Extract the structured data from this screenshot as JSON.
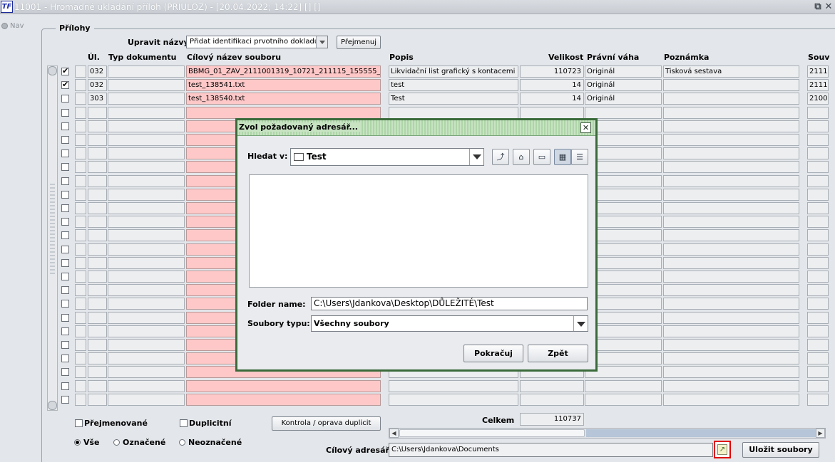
{
  "window": {
    "title": "11001 - Hromadné ukládání příloh (PRIULOZ) - [20.04.2022; 14:22] [] []",
    "logo": "TF"
  },
  "nav": {
    "label": "Nav"
  },
  "group": {
    "title": "Přílohy"
  },
  "controls": {
    "rename_label": "Upravit názvy",
    "rename_value": "Přidat identifikaci prvotního dokladu",
    "rename_button": "Přejmenuj"
  },
  "table": {
    "headers": {
      "ul": "Úl.",
      "typ": "Typ dokumentu",
      "nazev": "Cílový název souboru",
      "popis": "Popis",
      "velikost": "Velikost",
      "vaha": "Právní váha",
      "poznamka": "Poznámka",
      "souv": "Souv"
    },
    "rows": [
      {
        "checked": true,
        "ul": "032",
        "typ": "",
        "nazev": "BBMG_01_ZAV_2111001319_10721_211115_155555_",
        "popis": "Likvidační list grafický s kontacemi",
        "velikost": "110723",
        "vaha": "Originál",
        "poznamka": "Tisková sestava",
        "souv": "2111"
      },
      {
        "checked": true,
        "ul": "032",
        "typ": "",
        "nazev": "test_138541.txt",
        "popis": "test",
        "velikost": "14",
        "vaha": "Originál",
        "poznamka": "",
        "souv": "2111"
      },
      {
        "checked": false,
        "ul": "303",
        "typ": "",
        "nazev": "test_138540.txt",
        "popis": "Test",
        "velikost": "14",
        "vaha": "Originál",
        "poznamka": "",
        "souv": "2100"
      }
    ],
    "empty_rows": 22
  },
  "bottom": {
    "prejmenovane": "Přejmenované",
    "duplicitni": "Duplicitní",
    "kontrola_button": "Kontrola / oprava duplicit",
    "celkem_label": "Celkem",
    "celkem_value": "110737",
    "filter": {
      "vse": "Vše",
      "oznacene": "Označené",
      "neoznacene": "Neoznačené",
      "selected": "vse"
    },
    "target_label": "Cílový adresář",
    "target_value": "C:\\Users\\Jdankova\\Documents",
    "save_button": "Uložit soubory"
  },
  "dialog": {
    "title": "Zvol požadovaný adresář...",
    "look_in_label": "Hledat v:",
    "look_in_value": "Test",
    "folder_name_label": "Folder name:",
    "folder_name_value": "C:\\Users\\Jdankova\\Desktop\\DŮLEŽITÉ\\Test",
    "file_type_label": "Soubory typu:",
    "file_type_value": "Všechny soubory",
    "continue_button": "Pokračuj",
    "back_button": "Zpět"
  },
  "colors": {
    "required_field": "#ffc8c8",
    "dialog_border": "#3a6a3a",
    "dialog_title": "#c7e3c2",
    "highlight": "#e00000"
  }
}
